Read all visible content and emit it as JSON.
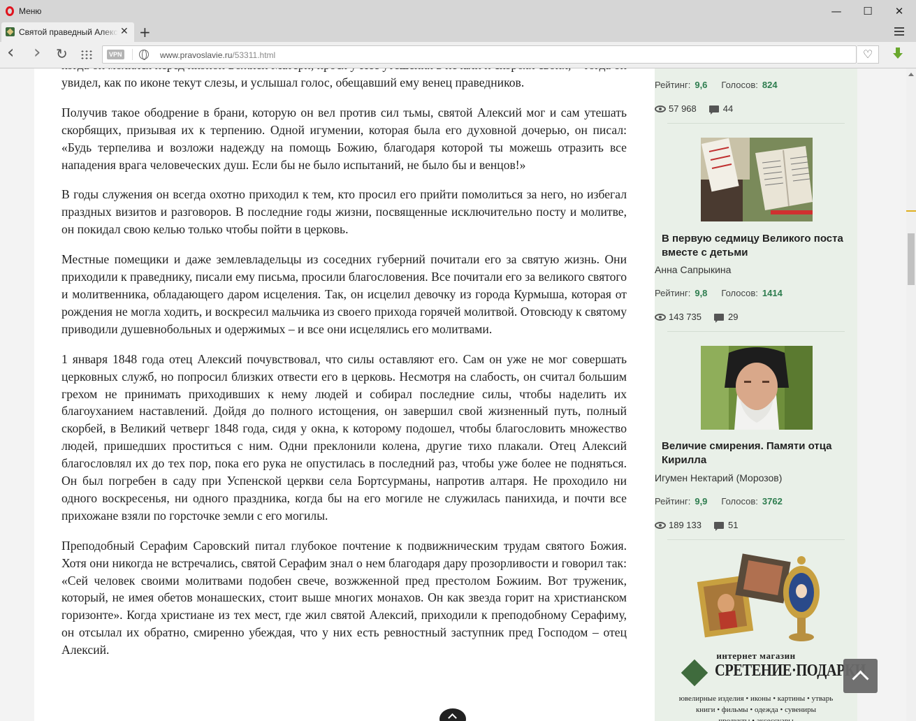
{
  "window": {
    "menu_label": "Меню",
    "minimize": "—",
    "maximize": "☐",
    "close": "✕"
  },
  "tab": {
    "title": "Святой праведный Алексий",
    "close": "✕",
    "new_tab": "+"
  },
  "toolbar": {
    "back": "‹",
    "forward": "›",
    "reload": "↻",
    "vpn": "VPN",
    "url_host": "www.pravoslavie.ru",
    "url_path": "/53311.html",
    "heart": "♡"
  },
  "article": {
    "paragraphs": [
      "когда он молился перед иконой Божией Матери, прося у Нее утешения в печали и скорбях своих, – тогда он увидел, как по иконе текут слезы, и услышал голос, обещавший ему венец праведников.",
      "Получив такое ободрение в брани, которую он вел против сил тьмы, святой Алексий мог и сам утешать скорбящих, призывая их к терпению. Одной игумении, которая была его духовной дочерью, он писал: «Будь терпелива и возложи надежду на помощь Божию, благодаря которой ты можешь отразить все нападения врага человеческих душ. Если бы не было испытаний, не было бы и венцов!»",
      "В годы служения он всегда охотно приходил к тем, кто просил его прийти помолиться за него, но избегал праздных визитов и разговоров. В последние годы жизни, посвященные исключительно посту и молитве, он покидал свою келью только чтобы пойти в церковь.",
      "Местные помещики и даже землевладельцы из соседних губерний почитали его за святую жизнь. Они приходили к праведнику, писали ему письма, просили благословения. Все почитали его за великого святого и молитвенника, обладающего даром исцеления. Так, он исцелил девочку из города Курмыша, которая от рождения не могла ходить, и воскресил мальчика из своего прихода горячей молитвой. Отовсюду к святому приводили душевнобольных и одержимых – и все они исцелялись его молитвами.",
      "1 января 1848 года отец Алексий почувствовал, что силы оставляют его. Сам он уже не мог совершать церковных служб, но попросил близких отвести его в церковь. Несмотря на слабость, он считал большим грехом не принимать приходивших к нему людей и собирал последние силы, чтобы наделить их благоуханием наставлений. Дойдя до полного истощения, он завершил свой жизненный путь, полный скорбей, в Великий четверг 1848 года, сидя у окна, к которому подошел, чтобы благословить множество людей, пришедших проститься с ним. Одни преклонили колена, другие тихо плакали. Отец Алексий благословлял их до тех пор, пока его рука не опустилась в последний раз, чтобы уже более не подняться. Он был погребен в саду при Успенской церкви села Бортсурманы, напротив алтаря. Не проходило ни одного воскресенья, ни одного праздника, когда бы на его могиле не служилась панихида, и почти все прихожане взяли по горсточке земли с его могилы.",
      "Преподобный Серафим Саровский питал глубокое почтение к подвижническим трудам святого Божия. Хотя они никогда не встречались, святой Серафим знал о нем благодаря дару прозорливости и говорил так: «Сей человек своими молитвами подобен свече, возжженной пред престолом Божиим. Вот труженик, который, не имея обетов монашеских, стоит выше многих монахов. Он как звезда горит на христианском горизонте». Когда христиане из тех мест, где жил святой Алексий, приходили к преподобному Серафиму, он отсылал их обратно, смиренно убеждая, что у них есть ревностный заступник пред Господом – отец Алексий."
    ]
  },
  "sidebar": {
    "rating_label": "Рейтинг:",
    "votes_label": "Голосов:",
    "cards": [
      {
        "title": "",
        "author": "",
        "rating": "9,6",
        "votes": "824",
        "views": "57 968",
        "comments": "44"
      },
      {
        "title": "В первую седмицу Великого поста вместе с детьми",
        "author": "Анна Сапрыкина",
        "rating": "9,8",
        "votes": "1414",
        "views": "143 735",
        "comments": "29"
      },
      {
        "title": "Величие смирения. Памяти отца Кирилла",
        "author": "Игумен Нектарий (Морозов)",
        "rating": "9,9",
        "votes": "3762",
        "views": "189 133",
        "comments": "51"
      }
    ],
    "ad": {
      "kicker": "интернет магазин",
      "name": "СРЕТЕНИЕ·ПОДАРКИ",
      "desc_line1": "ювелирные изделия • иконы • картины • утварь",
      "desc_line2": "книги • фильмы • одежда • сувениры",
      "desc_line3": "продукты • аксессуары"
    }
  }
}
